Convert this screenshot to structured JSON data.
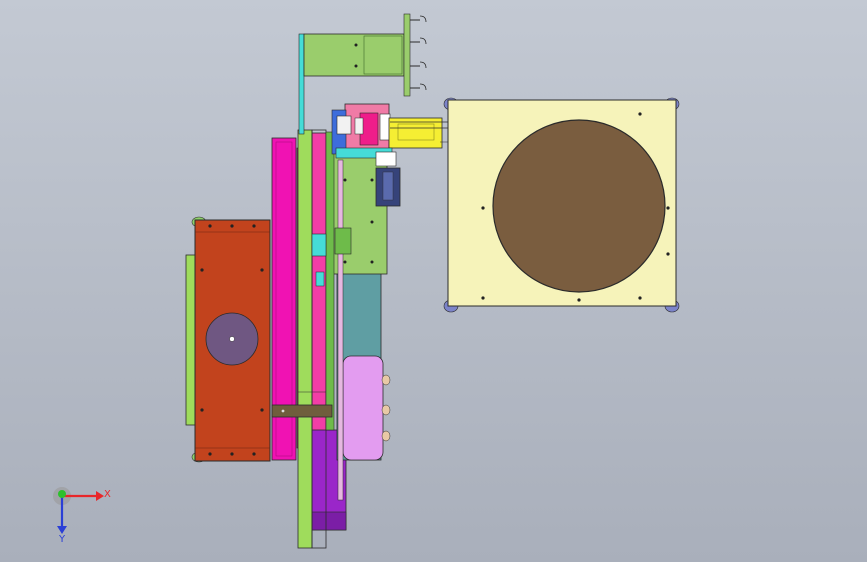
{
  "colors": {
    "background_top": "#c3c9d3",
    "background_bottom": "#a9afbb",
    "rust_block": "#c2431d",
    "rust_disc": "#6f5782",
    "magenta_plate": "#f012b3",
    "pink_plate": "#f23ea6",
    "green_frame": "#9fdc5c",
    "light_green_plate": "#9acd6c",
    "teal_column": "#5f9ea3",
    "purple_block": "#9a26c9",
    "lavender_cylinder": "#e39cf0",
    "yellow_slider": "#f5ee33",
    "cream_table": "#f6f3ba",
    "brown_disc": "#7a5d3f",
    "olive_clamp": "#6f5e3d",
    "cyan_rail": "#45dcd7",
    "feet_blue": "#7c84c9"
  },
  "axes": {
    "x_label": "X",
    "y_label": "Y",
    "x_color": "#e8262a",
    "y_color": "#2a3fd6",
    "z_color": "#2cc02c"
  }
}
